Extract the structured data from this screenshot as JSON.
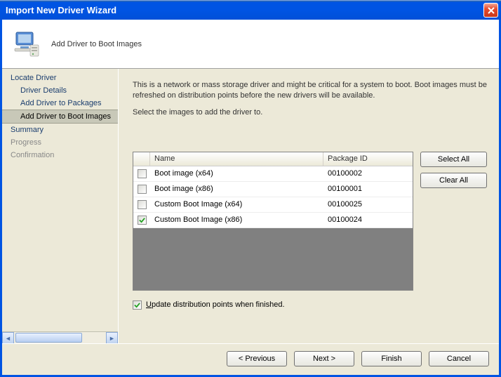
{
  "window": {
    "title": "Import New Driver Wizard"
  },
  "header": {
    "title": "Add Driver to Boot Images"
  },
  "sidebar": {
    "items": [
      {
        "label": "Locate Driver",
        "level": 0,
        "state": "done"
      },
      {
        "label": "Driver Details",
        "level": 1,
        "state": "done"
      },
      {
        "label": "Add Driver to Packages",
        "level": 1,
        "state": "done"
      },
      {
        "label": "Add Driver to Boot Images",
        "level": 1,
        "state": "current"
      },
      {
        "label": "Summary",
        "level": 0,
        "state": "done"
      },
      {
        "label": "Progress",
        "level": 0,
        "state": "future"
      },
      {
        "label": "Confirmation",
        "level": 0,
        "state": "future"
      }
    ]
  },
  "main": {
    "description": "This is a network or mass storage driver and might be critical for a system to boot.  Boot images must be refreshed on distribution points before the new drivers will be available.",
    "subdescription": "Select the images to add the driver to.",
    "columns": {
      "name": "Name",
      "pkg": "Package ID"
    },
    "rows": [
      {
        "checked": false,
        "name": "Boot image (x64)",
        "pkg": "00100002"
      },
      {
        "checked": false,
        "name": "Boot image (x86)",
        "pkg": "00100001"
      },
      {
        "checked": false,
        "name": "Custom Boot Image (x64)",
        "pkg": "00100025"
      },
      {
        "checked": true,
        "name": "Custom Boot Image (x86)",
        "pkg": "00100024"
      }
    ],
    "select_all": "Select All",
    "clear_all": "Clear All",
    "update_label_pre": "U",
    "update_label_post": "pdate distribution points when finished.",
    "update_checked": true
  },
  "footer": {
    "previous": "< Previous",
    "next": "Next >",
    "finish": "Finish",
    "cancel": "Cancel"
  }
}
